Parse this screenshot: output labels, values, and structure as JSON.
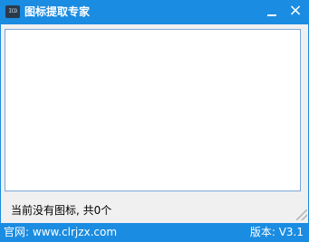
{
  "window": {
    "title": "图标提取专家",
    "icon_label": "ICO",
    "icon": "app-icon",
    "close_glyph": "×",
    "accent_color": "#1a8ce1"
  },
  "main": {
    "status_text": "当前没有图标, 共0个"
  },
  "footer": {
    "website": "官网: www.clrjzx.com",
    "version": "版本: V3.1"
  }
}
